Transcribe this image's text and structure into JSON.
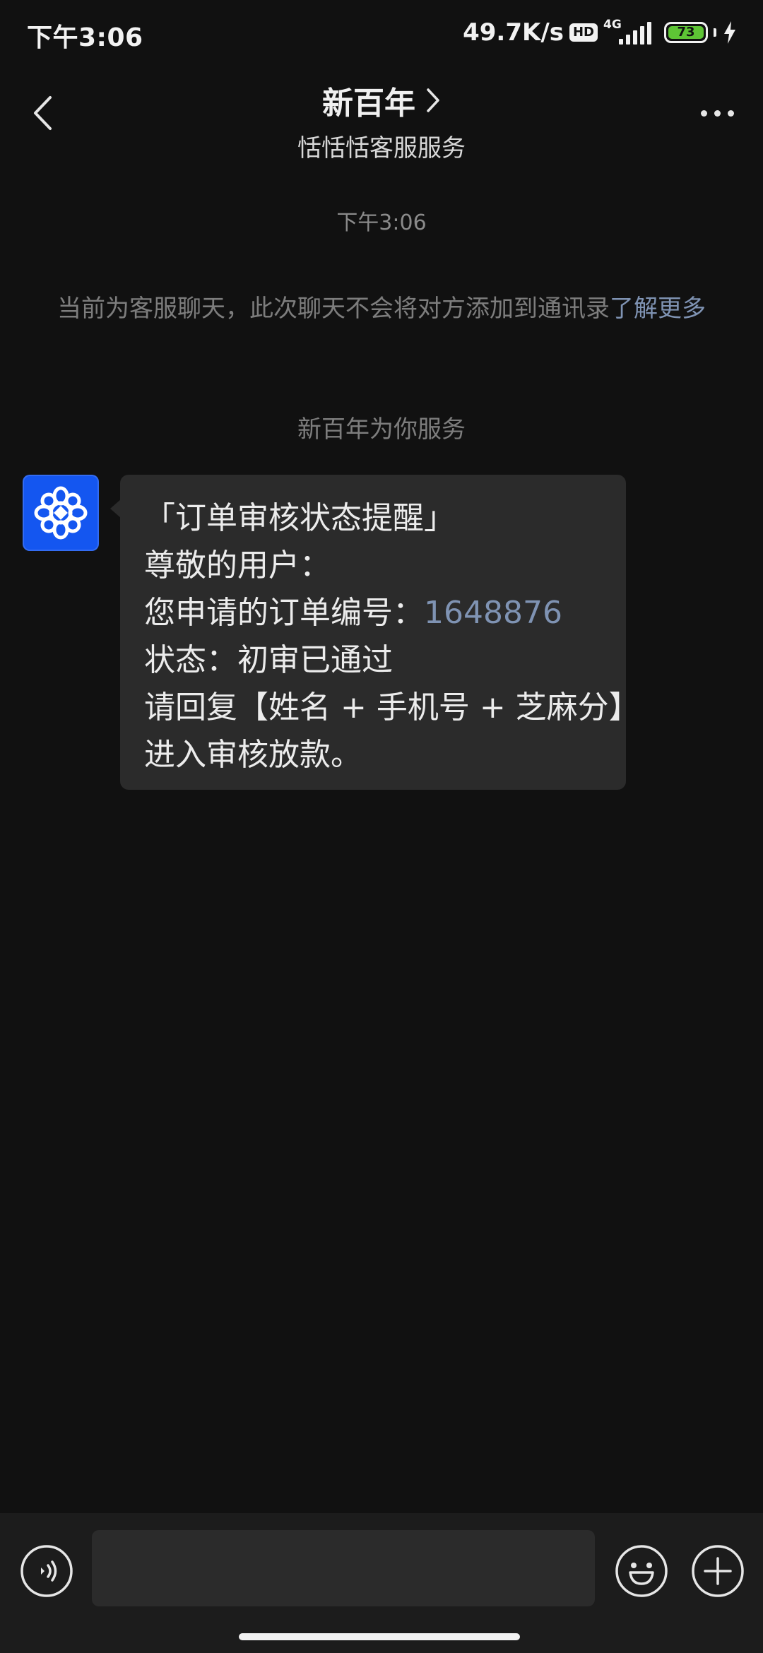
{
  "status_bar": {
    "time": "下午3:06",
    "net_speed": "49.7K/s",
    "hd": "HD",
    "network": "4G",
    "battery": "73",
    "battery_color": "#5ec435"
  },
  "header": {
    "title": "新百年",
    "subtitle": "恬恬恬客服服务",
    "back_icon": "chevron-left-icon",
    "more_icon": "more-horizontal-icon"
  },
  "chat": {
    "timestamp": "下午3:06",
    "notice_text": "当前为客服聊天，此次聊天不会将对方添加到通讯录",
    "notice_link": "了解更多",
    "service_line": "新百年为你服务",
    "message": {
      "line1": "「订单审核状态提醒」",
      "line2": "尊敬的用户：",
      "line3_prefix": "您申请的订单编号：",
      "order_number": "1648876",
      "line4": "状态：初审已通过",
      "line5": "请回复【姓名 + 手机号 + 芝麻分】",
      "line6": "进入审核放款。"
    }
  },
  "input_bar": {
    "placeholder": "",
    "voice_icon": "voice-icon",
    "emoji_icon": "emoji-icon",
    "plus_icon": "plus-icon"
  },
  "colors": {
    "background": "#111111",
    "bubble": "#2b2b2b",
    "link": "#7f93b3",
    "avatar_bg": "#1456f0"
  }
}
